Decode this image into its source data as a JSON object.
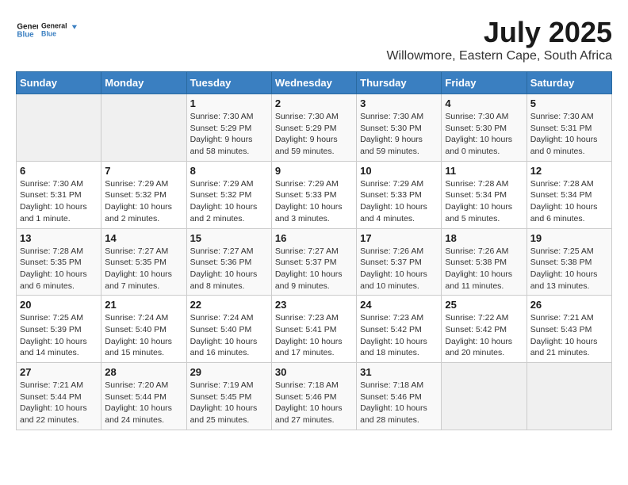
{
  "logo": {
    "line1": "General",
    "line2": "Blue"
  },
  "title": "July 2025",
  "location": "Willowmore, Eastern Cape, South Africa",
  "days_of_week": [
    "Sunday",
    "Monday",
    "Tuesday",
    "Wednesday",
    "Thursday",
    "Friday",
    "Saturday"
  ],
  "weeks": [
    [
      {
        "day": "",
        "sunrise": "",
        "sunset": "",
        "daylight": "",
        "empty": true
      },
      {
        "day": "",
        "sunrise": "",
        "sunset": "",
        "daylight": "",
        "empty": true
      },
      {
        "day": "1",
        "sunrise": "Sunrise: 7:30 AM",
        "sunset": "Sunset: 5:29 PM",
        "daylight": "Daylight: 9 hours and 58 minutes."
      },
      {
        "day": "2",
        "sunrise": "Sunrise: 7:30 AM",
        "sunset": "Sunset: 5:29 PM",
        "daylight": "Daylight: 9 hours and 59 minutes."
      },
      {
        "day": "3",
        "sunrise": "Sunrise: 7:30 AM",
        "sunset": "Sunset: 5:30 PM",
        "daylight": "Daylight: 9 hours and 59 minutes."
      },
      {
        "day": "4",
        "sunrise": "Sunrise: 7:30 AM",
        "sunset": "Sunset: 5:30 PM",
        "daylight": "Daylight: 10 hours and 0 minutes."
      },
      {
        "day": "5",
        "sunrise": "Sunrise: 7:30 AM",
        "sunset": "Sunset: 5:31 PM",
        "daylight": "Daylight: 10 hours and 0 minutes."
      }
    ],
    [
      {
        "day": "6",
        "sunrise": "Sunrise: 7:30 AM",
        "sunset": "Sunset: 5:31 PM",
        "daylight": "Daylight: 10 hours and 1 minute."
      },
      {
        "day": "7",
        "sunrise": "Sunrise: 7:29 AM",
        "sunset": "Sunset: 5:32 PM",
        "daylight": "Daylight: 10 hours and 2 minutes."
      },
      {
        "day": "8",
        "sunrise": "Sunrise: 7:29 AM",
        "sunset": "Sunset: 5:32 PM",
        "daylight": "Daylight: 10 hours and 2 minutes."
      },
      {
        "day": "9",
        "sunrise": "Sunrise: 7:29 AM",
        "sunset": "Sunset: 5:33 PM",
        "daylight": "Daylight: 10 hours and 3 minutes."
      },
      {
        "day": "10",
        "sunrise": "Sunrise: 7:29 AM",
        "sunset": "Sunset: 5:33 PM",
        "daylight": "Daylight: 10 hours and 4 minutes."
      },
      {
        "day": "11",
        "sunrise": "Sunrise: 7:28 AM",
        "sunset": "Sunset: 5:34 PM",
        "daylight": "Daylight: 10 hours and 5 minutes."
      },
      {
        "day": "12",
        "sunrise": "Sunrise: 7:28 AM",
        "sunset": "Sunset: 5:34 PM",
        "daylight": "Daylight: 10 hours and 6 minutes."
      }
    ],
    [
      {
        "day": "13",
        "sunrise": "Sunrise: 7:28 AM",
        "sunset": "Sunset: 5:35 PM",
        "daylight": "Daylight: 10 hours and 6 minutes."
      },
      {
        "day": "14",
        "sunrise": "Sunrise: 7:27 AM",
        "sunset": "Sunset: 5:35 PM",
        "daylight": "Daylight: 10 hours and 7 minutes."
      },
      {
        "day": "15",
        "sunrise": "Sunrise: 7:27 AM",
        "sunset": "Sunset: 5:36 PM",
        "daylight": "Daylight: 10 hours and 8 minutes."
      },
      {
        "day": "16",
        "sunrise": "Sunrise: 7:27 AM",
        "sunset": "Sunset: 5:37 PM",
        "daylight": "Daylight: 10 hours and 9 minutes."
      },
      {
        "day": "17",
        "sunrise": "Sunrise: 7:26 AM",
        "sunset": "Sunset: 5:37 PM",
        "daylight": "Daylight: 10 hours and 10 minutes."
      },
      {
        "day": "18",
        "sunrise": "Sunrise: 7:26 AM",
        "sunset": "Sunset: 5:38 PM",
        "daylight": "Daylight: 10 hours and 11 minutes."
      },
      {
        "day": "19",
        "sunrise": "Sunrise: 7:25 AM",
        "sunset": "Sunset: 5:38 PM",
        "daylight": "Daylight: 10 hours and 13 minutes."
      }
    ],
    [
      {
        "day": "20",
        "sunrise": "Sunrise: 7:25 AM",
        "sunset": "Sunset: 5:39 PM",
        "daylight": "Daylight: 10 hours and 14 minutes."
      },
      {
        "day": "21",
        "sunrise": "Sunrise: 7:24 AM",
        "sunset": "Sunset: 5:40 PM",
        "daylight": "Daylight: 10 hours and 15 minutes."
      },
      {
        "day": "22",
        "sunrise": "Sunrise: 7:24 AM",
        "sunset": "Sunset: 5:40 PM",
        "daylight": "Daylight: 10 hours and 16 minutes."
      },
      {
        "day": "23",
        "sunrise": "Sunrise: 7:23 AM",
        "sunset": "Sunset: 5:41 PM",
        "daylight": "Daylight: 10 hours and 17 minutes."
      },
      {
        "day": "24",
        "sunrise": "Sunrise: 7:23 AM",
        "sunset": "Sunset: 5:42 PM",
        "daylight": "Daylight: 10 hours and 18 minutes."
      },
      {
        "day": "25",
        "sunrise": "Sunrise: 7:22 AM",
        "sunset": "Sunset: 5:42 PM",
        "daylight": "Daylight: 10 hours and 20 minutes."
      },
      {
        "day": "26",
        "sunrise": "Sunrise: 7:21 AM",
        "sunset": "Sunset: 5:43 PM",
        "daylight": "Daylight: 10 hours and 21 minutes."
      }
    ],
    [
      {
        "day": "27",
        "sunrise": "Sunrise: 7:21 AM",
        "sunset": "Sunset: 5:44 PM",
        "daylight": "Daylight: 10 hours and 22 minutes."
      },
      {
        "day": "28",
        "sunrise": "Sunrise: 7:20 AM",
        "sunset": "Sunset: 5:44 PM",
        "daylight": "Daylight: 10 hours and 24 minutes."
      },
      {
        "day": "29",
        "sunrise": "Sunrise: 7:19 AM",
        "sunset": "Sunset: 5:45 PM",
        "daylight": "Daylight: 10 hours and 25 minutes."
      },
      {
        "day": "30",
        "sunrise": "Sunrise: 7:18 AM",
        "sunset": "Sunset: 5:46 PM",
        "daylight": "Daylight: 10 hours and 27 minutes."
      },
      {
        "day": "31",
        "sunrise": "Sunrise: 7:18 AM",
        "sunset": "Sunset: 5:46 PM",
        "daylight": "Daylight: 10 hours and 28 minutes."
      },
      {
        "day": "",
        "sunrise": "",
        "sunset": "",
        "daylight": "",
        "empty": true
      },
      {
        "day": "",
        "sunrise": "",
        "sunset": "",
        "daylight": "",
        "empty": true
      }
    ]
  ]
}
